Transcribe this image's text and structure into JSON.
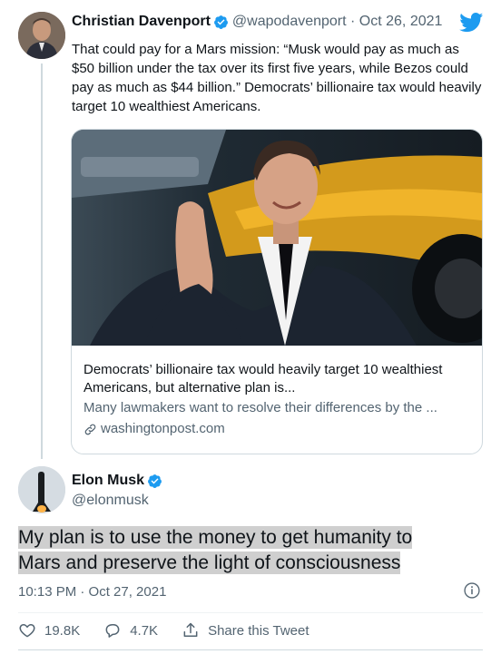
{
  "quoted_tweet": {
    "author_name": "Christian Davenport",
    "author_handle": "@wapodavenport",
    "date": "Oct 26, 2021",
    "text": "That could pay for a Mars mission: “Musk would pay as much as $50 billion under the tax over its first five years, while Bezos could pay as much as $44 billion.” Democrats’ billionaire tax would heavily target 10 wealthiest Americans.",
    "card": {
      "title": "Democrats’ billionaire tax would heavily target 10 wealthiest Americans, but alternative plan is...",
      "description": "Many lawmakers want to resolve their differences by the ...",
      "domain": "washingtonpost.com"
    }
  },
  "tweet": {
    "author_name": "Elon Musk",
    "author_handle": "@elonmusk",
    "text_line1": "My plan is to use the money to get humanity to",
    "text_line2": "Mars and preserve the light of consciousness",
    "timestamp": "10:13 PM · Oct 27, 2021",
    "likes": "19.8K",
    "replies": "4.7K",
    "share_label": "Share this Tweet"
  },
  "colors": {
    "text": "#0f1419",
    "secondary": "#536471",
    "twitter_blue": "#1d9bf0",
    "highlight": "#cfcfcf"
  },
  "icons": [
    "verified-badge-icon",
    "twitter-bird-icon",
    "link-icon",
    "info-icon",
    "heart-icon",
    "reply-icon",
    "share-icon"
  ]
}
